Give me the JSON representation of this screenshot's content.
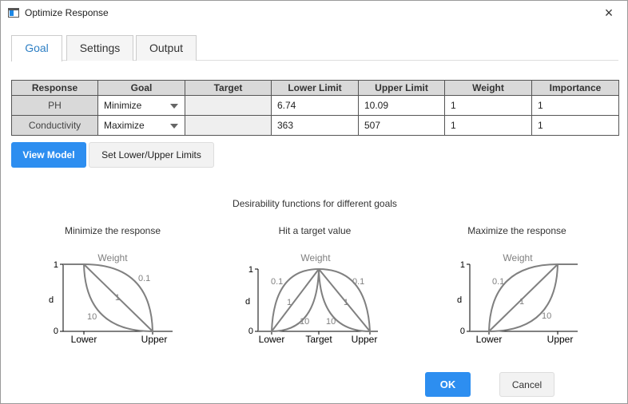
{
  "window": {
    "title": "Optimize Response",
    "close_icon": "×"
  },
  "tabs": [
    {
      "label": "Goal",
      "active": true
    },
    {
      "label": "Settings",
      "active": false
    },
    {
      "label": "Output",
      "active": false
    }
  ],
  "table": {
    "headers": [
      "Response",
      "Goal",
      "Target",
      "Lower Limit",
      "Upper Limit",
      "Weight",
      "Importance"
    ],
    "rows": [
      {
        "response": "PH",
        "goal": "Minimize",
        "target": "",
        "lower": "6.74",
        "upper": "10.09",
        "weight": "1",
        "importance": "1"
      },
      {
        "response": "Conductivity",
        "goal": "Maximize",
        "target": "",
        "lower": "363",
        "upper": "507",
        "weight": "1",
        "importance": "1"
      }
    ]
  },
  "buttons": {
    "view_model": "View Model",
    "set_limits": "Set Lower/Upper Limits",
    "ok": "OK",
    "cancel": "Cancel"
  },
  "desirability": {
    "title": "Desirability functions for different goals",
    "panels": [
      {
        "title": "Minimize the response",
        "weight_label": "Weight",
        "y_label": "d",
        "y_ticks": [
          "1",
          "0"
        ],
        "x_ticks": [
          "Lower",
          "Upper"
        ],
        "curve_labels": [
          "0.1",
          "1",
          "10"
        ]
      },
      {
        "title": "Hit a target value",
        "weight_label": "Weight",
        "y_label": "d",
        "y_ticks": [
          "1",
          "0"
        ],
        "x_ticks": [
          "Lower",
          "Target",
          "Upper"
        ],
        "curve_labels": [
          "0.1",
          "1",
          "10",
          "10",
          "1",
          "0.1"
        ]
      },
      {
        "title": "Maximize the response",
        "weight_label": "Weight",
        "y_label": "d",
        "y_ticks": [
          "1",
          "0"
        ],
        "x_ticks": [
          "Lower",
          "Upper"
        ],
        "curve_labels": [
          "0.1",
          "1",
          "10"
        ]
      }
    ]
  },
  "colors": {
    "accent": "#2d8ef0",
    "header_bg": "#d9d9d9",
    "curve": "#808080"
  }
}
